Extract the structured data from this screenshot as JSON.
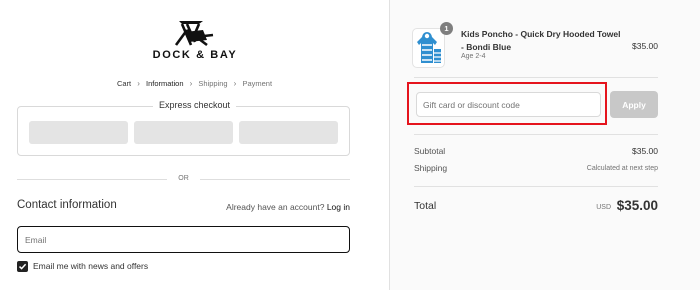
{
  "brand": {
    "logo_text": "DOCK & BAY",
    "logo_icon": "beach-chair-icon"
  },
  "breadcrumb": {
    "items": [
      "Cart",
      "Information",
      "Shipping",
      "Payment"
    ],
    "current": "Information",
    "separator_icon": "chevron-right-icon"
  },
  "express_checkout": {
    "title": "Express checkout",
    "buttons": [
      "payment-option-1",
      "payment-option-2",
      "payment-option-3"
    ]
  },
  "divider": {
    "text": "OR"
  },
  "contact": {
    "title": "Contact information",
    "account_prompt": "Already have an account?",
    "login_link": "Log in",
    "email_placeholder": "Email",
    "newsletter_label": "Email me with news and offers",
    "newsletter_checked": true
  },
  "order_summary": {
    "product": {
      "name": "Kids Poncho - Quick Dry Hooded Towel - Bondi Blue",
      "variant": "Age 2-4",
      "price": "$35.00",
      "quantity": "1",
      "image_icon": "poncho-towel-product-image"
    },
    "discount": {
      "placeholder": "Gift card or discount code",
      "apply_label": "Apply",
      "highlight_color": "#e5141d"
    },
    "subtotal_label": "Subtotal",
    "subtotal_value": "$35.00",
    "shipping_label": "Shipping",
    "shipping_value": "Calculated at next step",
    "total_label": "Total",
    "currency": "USD",
    "total_value": "$35.00"
  },
  "colors": {
    "text": "#333333",
    "panel_bg": "#fafafa",
    "apply_disabled": "#c8c8c8"
  }
}
